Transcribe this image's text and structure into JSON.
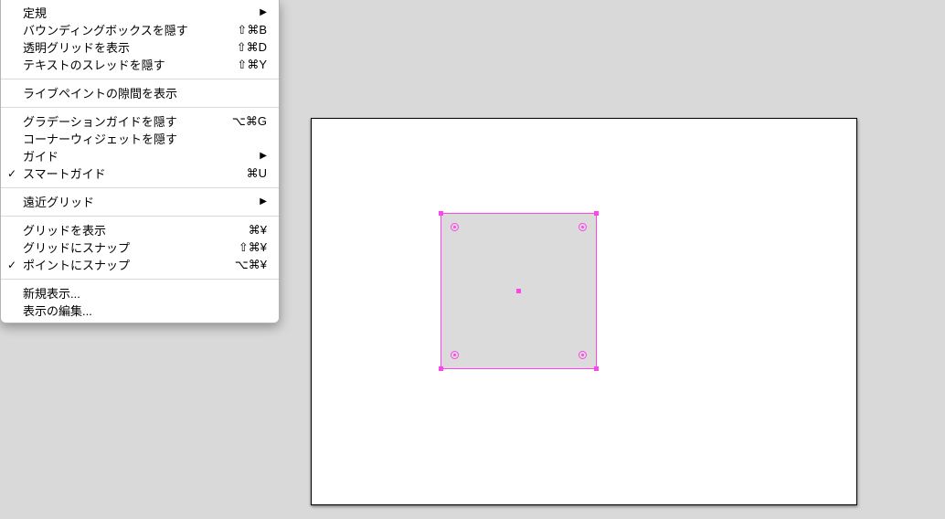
{
  "menu": {
    "name": "view-menu",
    "checkmark": "✓",
    "submenu_arrow": "▶",
    "items": [
      {
        "type": "item",
        "id": "rulers",
        "label": "定規",
        "submenu": true
      },
      {
        "type": "item",
        "id": "hide-bounding-box",
        "label": "バウンディングボックスを隠す",
        "shortcut": "⇧⌘B"
      },
      {
        "type": "item",
        "id": "show-transparency-grid",
        "label": "透明グリッドを表示",
        "shortcut": "⇧⌘D"
      },
      {
        "type": "item",
        "id": "hide-text-threads",
        "label": "テキストのスレッドを隠す",
        "shortcut": "⇧⌘Y"
      },
      {
        "type": "separator"
      },
      {
        "type": "item",
        "id": "show-live-paint-gaps",
        "label": "ライブペイントの隙間を表示"
      },
      {
        "type": "separator"
      },
      {
        "type": "item",
        "id": "hide-gradient-annotator",
        "label": "グラデーションガイドを隠す",
        "shortcut": "⌥⌘G"
      },
      {
        "type": "item",
        "id": "hide-corner-widget",
        "label": "コーナーウィジェットを隠す"
      },
      {
        "type": "item",
        "id": "guides",
        "label": "ガイド",
        "submenu": true
      },
      {
        "type": "item",
        "id": "smart-guides",
        "label": "スマートガイド",
        "shortcut": "⌘U",
        "checked": true
      },
      {
        "type": "separator"
      },
      {
        "type": "item",
        "id": "perspective-grid",
        "label": "遠近グリッド",
        "submenu": true
      },
      {
        "type": "separator"
      },
      {
        "type": "item",
        "id": "show-grid",
        "label": "グリッドを表示",
        "shortcut": "⌘¥"
      },
      {
        "type": "item",
        "id": "snap-to-grid",
        "label": "グリッドにスナップ",
        "shortcut": "⇧⌘¥"
      },
      {
        "type": "item",
        "id": "snap-to-point",
        "label": "ポイントにスナップ",
        "shortcut": "⌥⌘¥",
        "checked": true
      },
      {
        "type": "separator"
      },
      {
        "type": "item",
        "id": "new-view",
        "label": "新規表示..."
      },
      {
        "type": "item",
        "id": "edit-views",
        "label": "表示の編集..."
      }
    ]
  },
  "canvas": {
    "artboard": {
      "background": "#ffffff",
      "border": "#000000"
    },
    "selection": {
      "shape": "rectangle",
      "fill": "#dbdbdb",
      "handles": [
        "top-left",
        "top-right",
        "bottom-left",
        "bottom-right"
      ],
      "corner_widgets": 4,
      "center_point": true
    }
  },
  "colors": {
    "selection": "#fc46eb",
    "pasteboard": "#d9d9d9",
    "shape_fill": "#dbdbdb"
  }
}
